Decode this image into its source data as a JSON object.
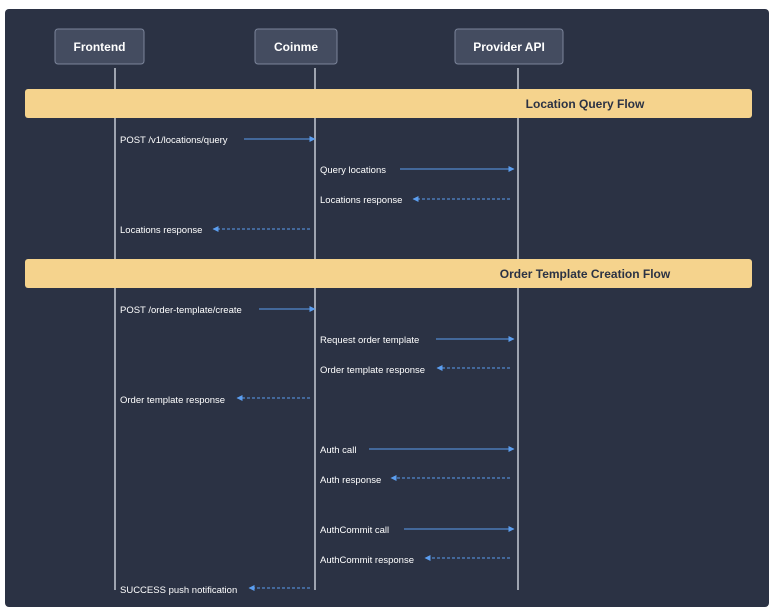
{
  "diagram": {
    "type": "sequence",
    "colors": {
      "background": "#2b3244",
      "actor_box_fill": "#444c60",
      "actor_box_stroke": "#7b849a",
      "lifeline": "#c4c9d3",
      "section_fill": "#f5d38d",
      "section_text": "#2b3244",
      "arrow": "#5b9ef0",
      "message_text": "#ffffff"
    },
    "actors": [
      {
        "id": "frontend",
        "name": "Frontend"
      },
      {
        "id": "coinme",
        "name": "Coinme"
      },
      {
        "id": "provider",
        "name": "Provider API"
      }
    ],
    "sections": [
      {
        "title": "Location Query Flow"
      },
      {
        "title": "Order Template Creation Flow"
      }
    ],
    "messages": [
      {
        "from": "frontend",
        "to": "coinme",
        "label": "POST /v1/locations/query",
        "style": "solid"
      },
      {
        "from": "coinme",
        "to": "provider",
        "label": "Query locations",
        "style": "solid"
      },
      {
        "from": "provider",
        "to": "coinme",
        "label": "Locations response",
        "style": "dashed"
      },
      {
        "from": "coinme",
        "to": "frontend",
        "label": "Locations response",
        "style": "dashed"
      },
      {
        "from": "frontend",
        "to": "coinme",
        "label": "POST /order-template/create",
        "style": "solid"
      },
      {
        "from": "coinme",
        "to": "provider",
        "label": "Request order template",
        "style": "solid"
      },
      {
        "from": "provider",
        "to": "coinme",
        "label": "Order template response",
        "style": "dashed"
      },
      {
        "from": "coinme",
        "to": "frontend",
        "label": "Order template response",
        "style": "dashed"
      },
      {
        "from": "coinme",
        "to": "provider",
        "label": "Auth call",
        "style": "solid"
      },
      {
        "from": "provider",
        "to": "coinme",
        "label": "Auth response",
        "style": "dashed"
      },
      {
        "from": "coinme",
        "to": "provider",
        "label": "AuthCommit call",
        "style": "solid"
      },
      {
        "from": "provider",
        "to": "coinme",
        "label": "AuthCommit response",
        "style": "dashed"
      },
      {
        "from": "coinme",
        "to": "frontend",
        "label": "SUCCESS push notification",
        "style": "dashed"
      }
    ]
  }
}
